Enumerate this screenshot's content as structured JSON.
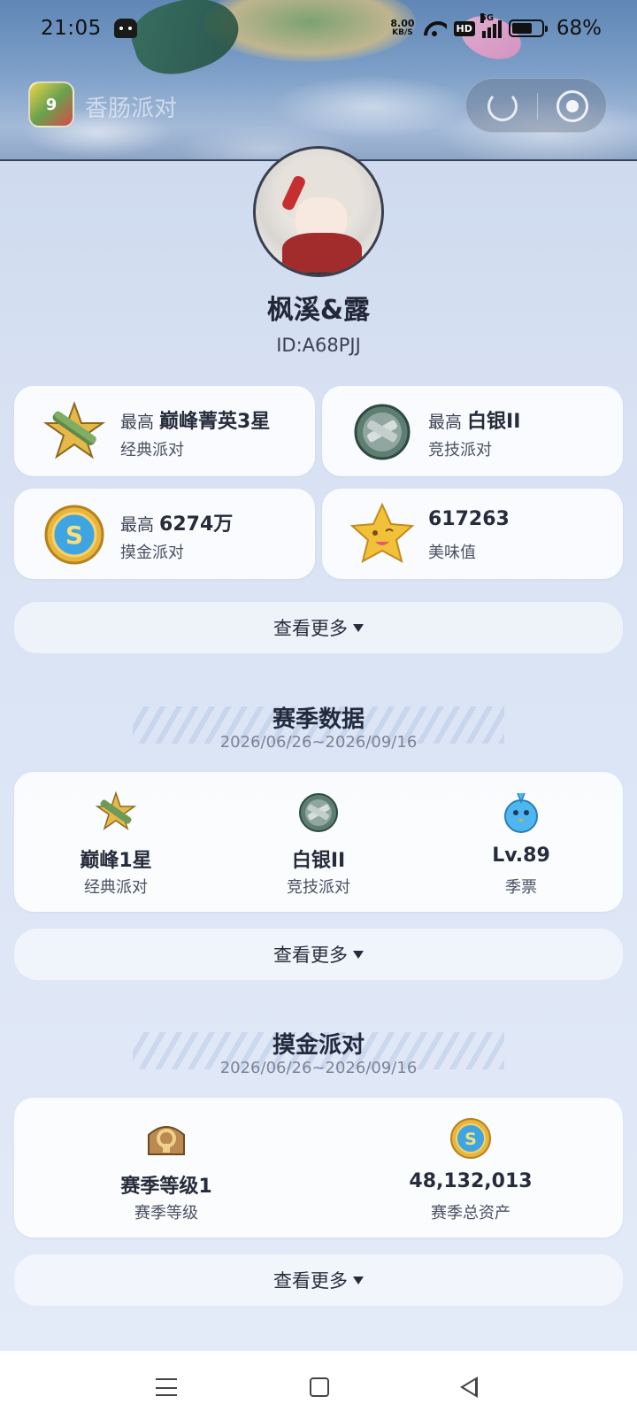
{
  "status_bar": {
    "time": "21:05",
    "net_speed_value": "8.00",
    "net_speed_unit": "KB/S",
    "hd_badge": "HD",
    "signal_label": "5G",
    "battery_level_pct": 68,
    "battery_text": "68%"
  },
  "app_bar": {
    "app_icon_text": "9",
    "app_name": "香肠派对"
  },
  "profile": {
    "nickname": "枫溪&露",
    "user_id": "ID:A68PJJ"
  },
  "stat_cards": [
    {
      "prefix": "最高",
      "value": "巅峰菁英3星",
      "label": "经典派对",
      "icon": "peak-rank-icon"
    },
    {
      "prefix": "最高",
      "value": "白银II",
      "label": "竞技派对",
      "icon": "silver-rank-icon"
    },
    {
      "prefix": "最高",
      "value": "6274万",
      "label": "摸金派对",
      "icon": "gold-coin-icon"
    },
    {
      "prefix": "",
      "value": "617263",
      "label": "美味值",
      "icon": "star-face-icon"
    }
  ],
  "see_more_label": "查看更多",
  "season_section": {
    "title": "赛季数据",
    "date_range": "2026/06/26~2026/09/16",
    "items": [
      {
        "value": "巅峰1星",
        "label": "经典派对",
        "icon": "peak-rank-icon"
      },
      {
        "value": "白银II",
        "label": "竞技派对",
        "icon": "silver-rank-icon"
      },
      {
        "value": "Lv.89",
        "label": "季票",
        "icon": "season-pass-chick-icon"
      }
    ]
  },
  "gold_section": {
    "title": "摸金派对",
    "date_range": "2026/06/26~2026/09/16",
    "items": [
      {
        "value": "赛季等级1",
        "label": "赛季等级",
        "icon": "season-level-badge-icon"
      },
      {
        "value": "48,132,013",
        "label": "赛季总资产",
        "icon": "gold-coin-icon"
      }
    ]
  },
  "colors": {
    "page_bg": "#d8e2f3",
    "card_bg": "#ffffff",
    "text_primary": "#262c3b",
    "text_muted": "#7d8394"
  }
}
